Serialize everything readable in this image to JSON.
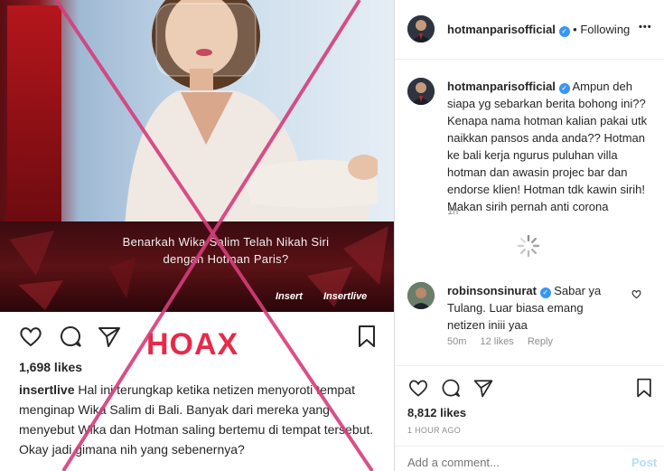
{
  "embedded_post": {
    "overlay_caption_line1": "Benarkah Wika Salim Telah Nikah Siri",
    "overlay_caption_line2": "dengan Hotman Paris?",
    "watermark1": "Insert",
    "watermark2": "Insertlive",
    "stamp": "HOAX",
    "likes": "1,698 likes",
    "caption_user": "insertlive",
    "caption_text": "Hal ini terungkap ketika netizen menyoroti tempat menginap Wika Salim di Bali. Banyak dari mereka yang menyebut Wika dan Hotman saling bertemu di tempat tersebut. Okay jadi gimana nih yang sebenernya?"
  },
  "header": {
    "username": "hotmanparisofficial",
    "separator": "•",
    "follow_state": "Following",
    "more": "•••"
  },
  "comments": [
    {
      "username": "hotmanparisofficial",
      "text": "Ampun deh siapa yg sebarkan berita bohong ini?? Kenapa nama hotman kalian pakai utk naikkan pansos anda anda?? Hotman ke bali kerja ngurus puluhan villa hotman dan awasin projec bar dan endorse klien! Hotman tdk kawin sirih! Makan sirih pernah anti corona",
      "time": "1h"
    },
    {
      "username": "robinsonsinurat",
      "text": "Sabar ya Tulang. Luar biasa emang netizen iniii yaa",
      "time": "50m",
      "likes": "12 likes",
      "reply": "Reply"
    }
  ],
  "post": {
    "likes": "8,812 likes",
    "time": "1 HOUR AGO"
  },
  "add_comment": {
    "placeholder": "Add a comment...",
    "post_label": "Post"
  },
  "colors": {
    "accent_blue": "#3897f0",
    "hoax_red": "#e62a49",
    "x_mark": "#d63d7b"
  }
}
